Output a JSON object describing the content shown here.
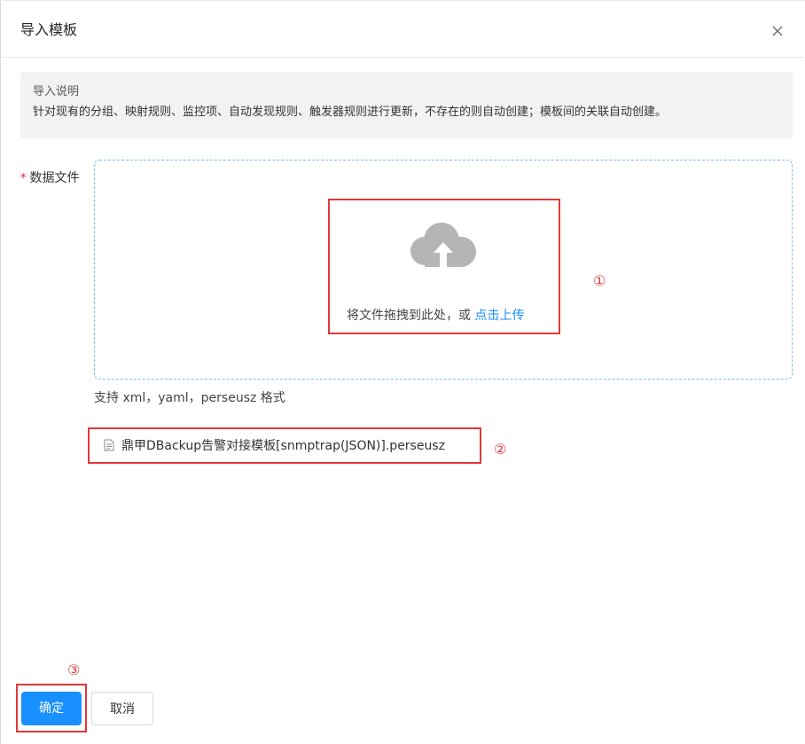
{
  "dialog": {
    "title": "导入模板",
    "close_icon": "close-icon"
  },
  "notice": {
    "title": "导入说明",
    "description": "针对现有的分组、映射规则、监控项、自动发现规则、触发器规则进行更新，不存在的则自动创建；模板间的关联自动创建。"
  },
  "form": {
    "required_mark": "*",
    "data_file_label": "数据文件",
    "upload_icon": "cloud-upload-icon",
    "drop_text": "将文件拖拽到此处，或",
    "upload_link": "点击上传",
    "hint": "支持 xml，yaml，perseusz 格式",
    "file_icon": "document-icon",
    "uploaded_file": "鼎甲DBackup告警对接模板[snmptrap(JSON)].perseusz"
  },
  "annotations": {
    "marker_1": "①",
    "marker_2": "②",
    "marker_3": "③",
    "color": "#e0383b"
  },
  "footer": {
    "confirm_label": "确定",
    "cancel_label": "取消"
  },
  "colors": {
    "primary": "#1890ff",
    "required": "#f5222d",
    "dropzone_border": "#7fb8ee"
  }
}
